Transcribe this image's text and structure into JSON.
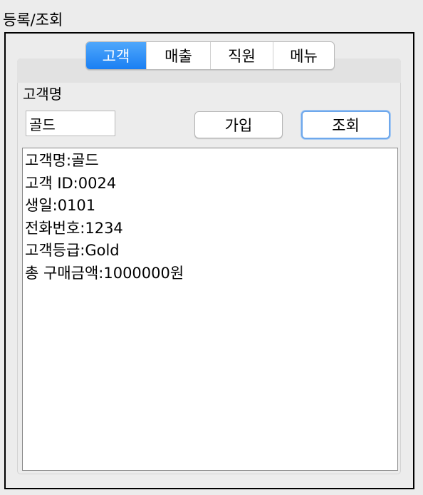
{
  "group": {
    "title": "등록/조회"
  },
  "tabs": [
    {
      "label": "고객",
      "active": true
    },
    {
      "label": "매출",
      "active": false
    },
    {
      "label": "직원",
      "active": false
    },
    {
      "label": "메뉴",
      "active": false
    }
  ],
  "form": {
    "name_label": "고객명",
    "name_value": "골드",
    "join_button": "가입",
    "query_button": "조회"
  },
  "result": {
    "lines": [
      "고객명:골드",
      "고객 ID:0024",
      "생일:0101",
      "전화번호:1234",
      "고객등급:Gold",
      "총 구매금액:1000000원"
    ]
  },
  "colors": {
    "active_tab": "#1a7ff3",
    "focus_ring": "#6ea8ec",
    "background": "#ececec"
  }
}
